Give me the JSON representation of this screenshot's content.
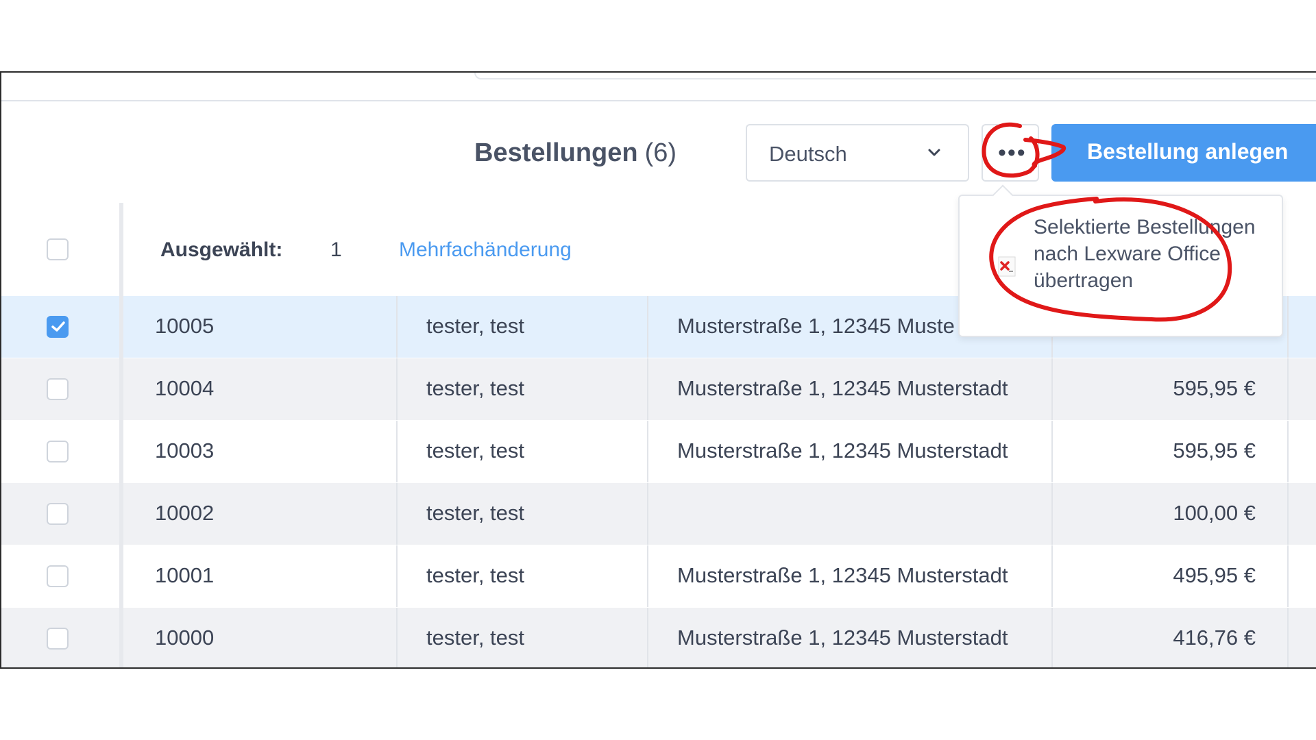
{
  "header": {
    "title": "Bestellungen",
    "count": "(6)",
    "language": "Deutsch",
    "more_label": "•••",
    "create_button": "Bestellung anlegen"
  },
  "selection": {
    "label": "Ausgewählt:",
    "count": "1",
    "bulk_edit": "Mehrfachänderung"
  },
  "menu": {
    "item": "Selektierte Bestellungen nach Lexware Office übertragen",
    "icon": "lexware-icon"
  },
  "orders": [
    {
      "id": "10005",
      "name": "tester, test",
      "address": "Musterstraße 1, 12345 Muste",
      "price": "",
      "checked": true
    },
    {
      "id": "10004",
      "name": "tester, test",
      "address": "Musterstraße 1, 12345 Musterstadt",
      "price": "595,95 €",
      "checked": false
    },
    {
      "id": "10003",
      "name": "tester, test",
      "address": "Musterstraße 1, 12345 Musterstadt",
      "price": "595,95 €",
      "checked": false
    },
    {
      "id": "10002",
      "name": "tester, test",
      "address": "",
      "price": "100,00 €",
      "checked": false
    },
    {
      "id": "10001",
      "name": "tester, test",
      "address": "Musterstraße 1, 12345 Musterstadt",
      "price": "495,95 €",
      "checked": false
    },
    {
      "id": "10000",
      "name": "tester, test",
      "address": "Musterstraße 1, 12345 Musterstadt",
      "price": "416,76 €",
      "checked": false
    }
  ],
  "colors": {
    "accent": "#4a9af0",
    "annotation": "#e01818",
    "selected_row": "#e3f0fd"
  }
}
